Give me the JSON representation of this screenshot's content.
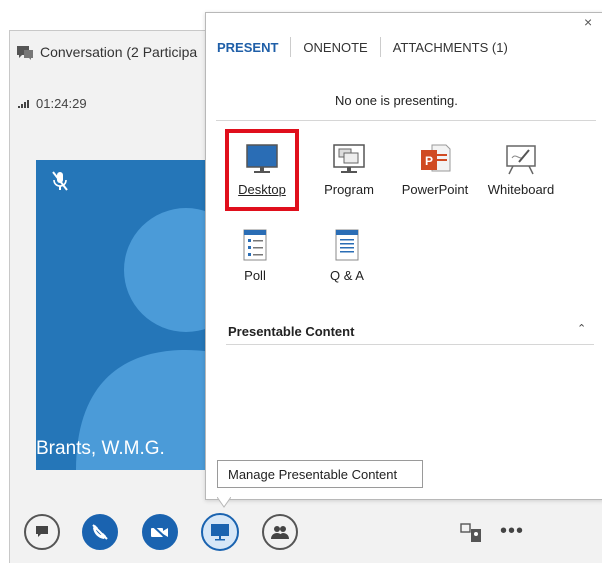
{
  "conversation": {
    "title": "Conversation (2 Participa",
    "signal_icon": "signal-bars-icon",
    "duration": "01:24:29",
    "participant_name": "Brants, W.M.G.",
    "mic_icon": "mic-muted-icon"
  },
  "present_panel": {
    "tabs": [
      {
        "label": "PRESENT"
      },
      {
        "label": "ONENOTE"
      },
      {
        "label": "ATTACHMENTS (1)"
      }
    ],
    "close_label": "×",
    "status": "No one is presenting.",
    "options": [
      {
        "label": "Desktop",
        "icon": "desktop-icon"
      },
      {
        "label": "Program",
        "icon": "program-icon"
      },
      {
        "label": "PowerPoint",
        "icon": "powerpoint-icon"
      },
      {
        "label": "Whiteboard",
        "icon": "whiteboard-icon"
      },
      {
        "label": "Poll",
        "icon": "poll-icon"
      },
      {
        "label": "Q & A",
        "icon": "qa-icon"
      }
    ],
    "section_title": "Presentable Content",
    "section_caret": "⌃",
    "manage_tooltip": "Manage Presentable Content"
  },
  "toolbar": {
    "more_label": "•••",
    "buttons": [
      "chat-icon",
      "call-muted-icon",
      "video-off-icon",
      "present-screen-icon",
      "participants-icon",
      "layout-icon"
    ]
  },
  "colors": {
    "accent": "#1f5fa8",
    "video_bg": "#2576b8",
    "highlight": "#e00f1c",
    "button_blue": "#1a63b0"
  }
}
